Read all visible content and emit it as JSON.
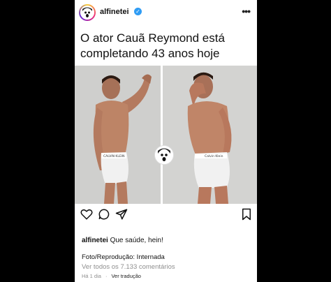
{
  "header": {
    "username": "alfinetei",
    "verified_icon": "verified-badge-icon",
    "more_icon": "ellipsis-icon"
  },
  "headline": "O ator Cauã Reymond está completando 43 anos hoje",
  "photos": [
    {
      "name": "left-photo",
      "underwear_text": "CALVIN KLEIN"
    },
    {
      "name": "right-photo",
      "underwear_text": "Calvin Klein"
    }
  ],
  "actions": {
    "like_icon": "heart-icon",
    "comment_icon": "comment-icon",
    "share_icon": "send-icon",
    "save_icon": "bookmark-icon"
  },
  "caption": {
    "username": "alfinetei",
    "text": "Que saúde, hein!"
  },
  "credit": "Foto/Reprodução: Internada",
  "comments_link": "Ver todos os 7.133 comentários",
  "meta": {
    "time": "Há 1 dia",
    "dot": "·",
    "translate": "Ver tradução"
  },
  "colors": {
    "verified": "#2f9cf4",
    "muted": "#8e8e8e",
    "underwear": "#f1f1f1"
  }
}
